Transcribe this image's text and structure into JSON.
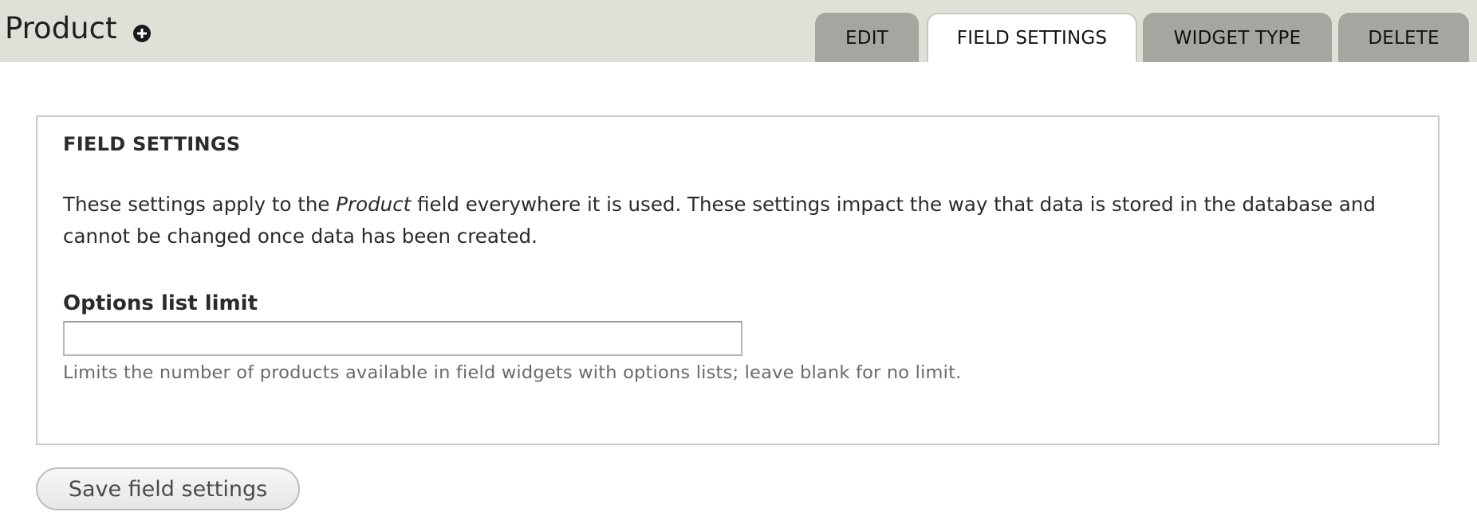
{
  "header": {
    "title": "Product",
    "add_icon": "plus-circle-icon"
  },
  "tabs": [
    {
      "label": "EDIT",
      "active": false
    },
    {
      "label": "FIELD SETTINGS",
      "active": true
    },
    {
      "label": "WIDGET TYPE",
      "active": false
    },
    {
      "label": "DELETE",
      "active": false
    }
  ],
  "fieldset": {
    "legend": "FIELD SETTINGS",
    "description_before": "These settings apply to the ",
    "description_emphasis": "Product",
    "description_after": " field everywhere it is used. These settings impact the way that data is stored in the database and cannot be changed once data has been created."
  },
  "options_limit": {
    "label": "Options list limit",
    "value": "",
    "help": "Limits the number of products available in field widgets with options lists; leave blank for no limit."
  },
  "actions": {
    "save_label": "Save field settings"
  },
  "colors": {
    "header_bg": "#e0e0d8",
    "tab_bg": "#a6a6a1",
    "tab_active_bg": "#ffffff",
    "border": "#c9c9c9"
  }
}
